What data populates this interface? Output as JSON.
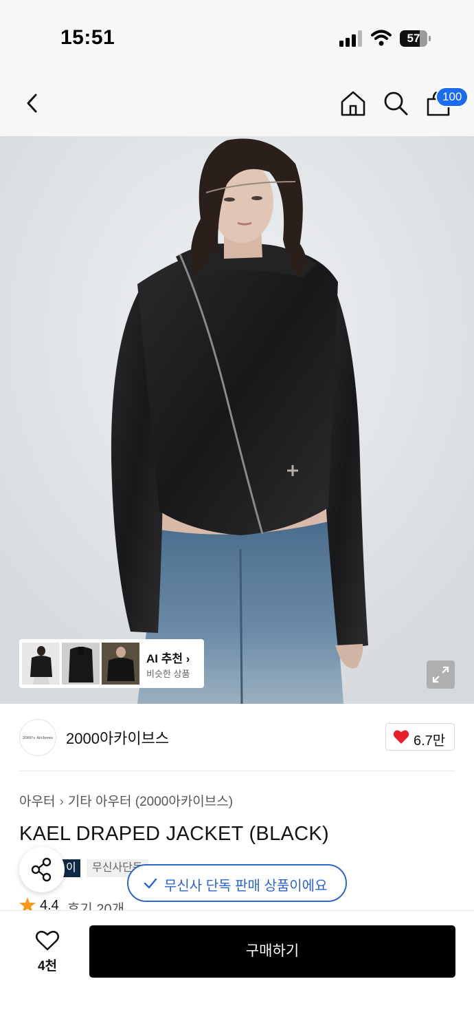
{
  "status_bar": {
    "time": "15:51",
    "battery": "57"
  },
  "nav": {
    "cart_count": "100"
  },
  "ai_recommend": {
    "title": "AI 추천",
    "subtitle": "비슷한 상품"
  },
  "brand": {
    "name": "2000아카이브스",
    "logo_text": "2000's Archives",
    "likes": "6.7만"
  },
  "breadcrumb": {
    "category": "아우터",
    "subcategory": "기타 아우터 (2000아카이브스)"
  },
  "product": {
    "title": "KAEL DRAPED JACKET (BLACK)",
    "tag_dark": "이",
    "tag_light": "무신사단독",
    "rating": "4.4",
    "reviews": "후기 20개"
  },
  "toast": {
    "text": "무신사 단독 판매 상품이에요"
  },
  "bottom": {
    "wish_count": "4천",
    "buy_label": "구매하기"
  },
  "colors": {
    "accent_blue": "#2a62d8",
    "badge_blue": "#1a6bf0",
    "heart_red": "#e8202a",
    "buy_black": "#000000"
  }
}
